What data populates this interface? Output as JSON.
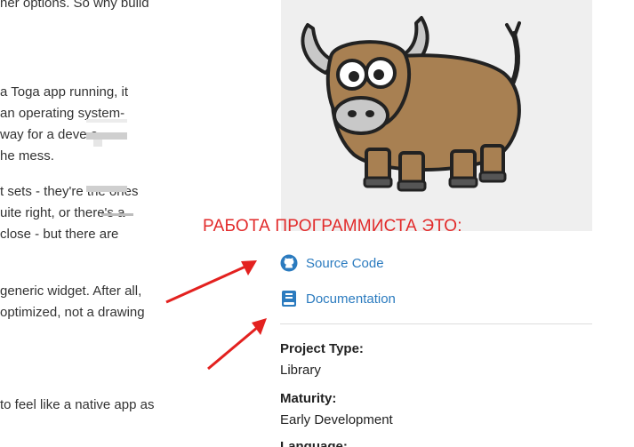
{
  "article": {
    "lines": [
      "her options. So why build",
      "a Toga app running, it",
      "an operating system-",
      "way for a deve      o",
      "he mess.",
      "t sets - they're the ones",
      "uite right, or there's a",
      "close - but there are",
      "generic widget. After all,",
      "optimized, not a drawing",
      " to feel like a native app as"
    ]
  },
  "sidebar": {
    "image_name": "toga yak mascot",
    "links": [
      {
        "icon": "github-icon",
        "label": "Source Code"
      },
      {
        "icon": "book-icon",
        "label": "Documentation"
      }
    ],
    "meta": [
      {
        "key": "Project Type:",
        "value": "Library"
      },
      {
        "key": "Maturity:",
        "value": "Early Development"
      },
      {
        "key": "Language:",
        "value": ""
      }
    ]
  },
  "overlay": {
    "caption": "РАБОТА ПРОГРАММИСТА ЭТО:",
    "arrow_color": "#e3211f"
  },
  "colors": {
    "link": "#2b7bbf",
    "caption": "#e22a2a",
    "image_bg": "#efefef"
  }
}
